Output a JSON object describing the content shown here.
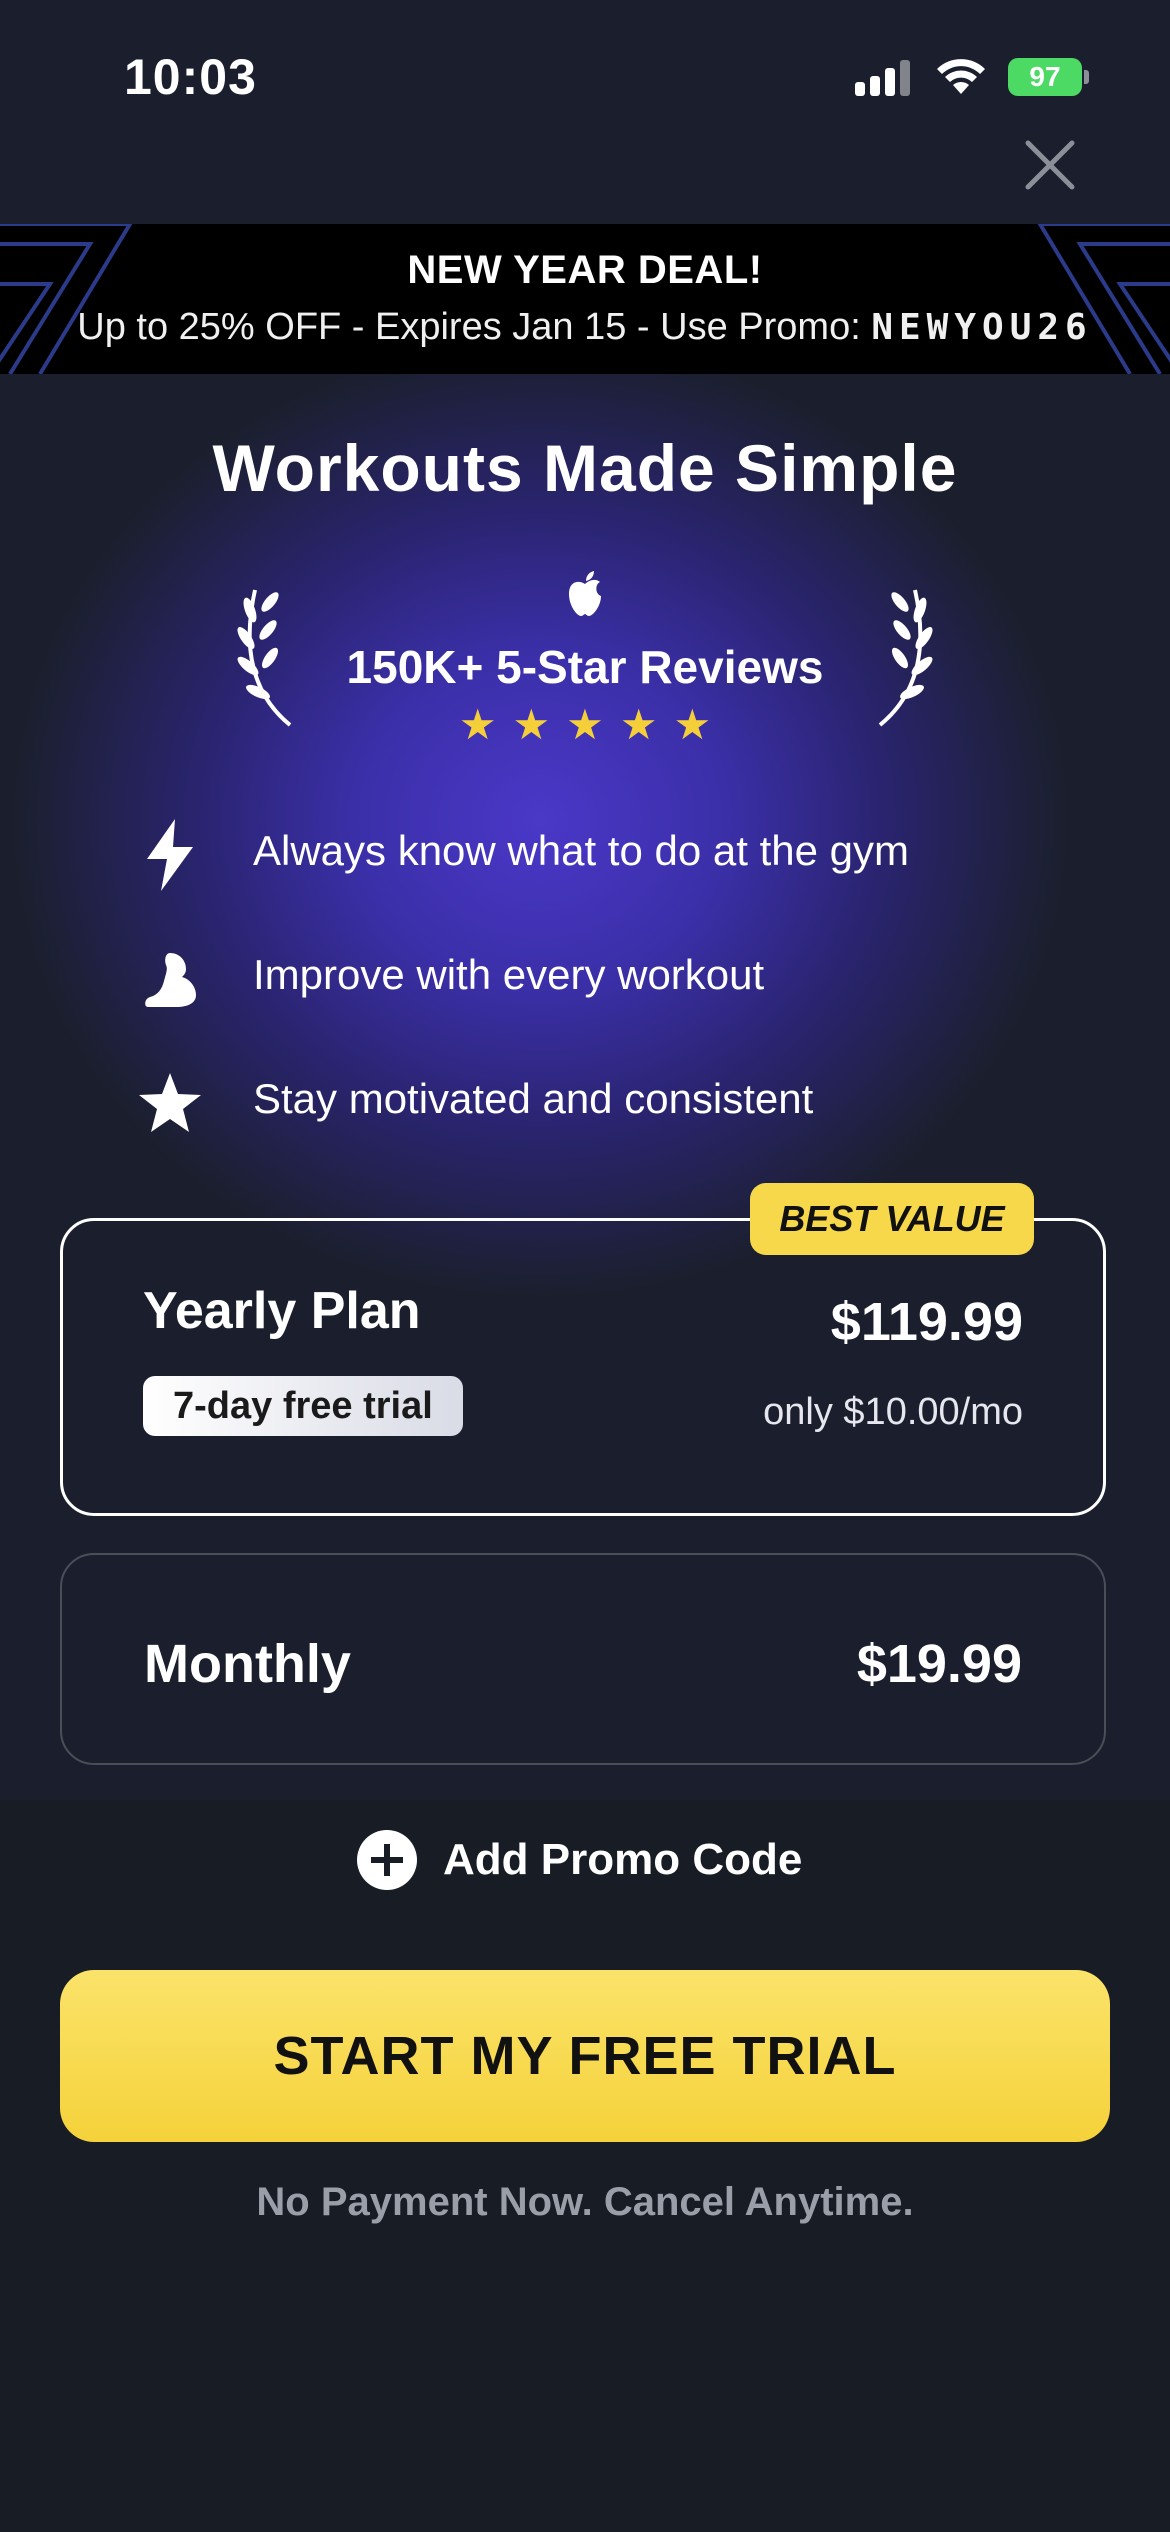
{
  "status_bar": {
    "time": "10:03",
    "battery": "97"
  },
  "promo_banner": {
    "title": "NEW YEAR DEAL!",
    "line": "Up to 25% OFF - Expires Jan 15 - Use Promo:",
    "code": "NEWYOU26"
  },
  "headline": "Workouts Made Simple",
  "reviews": {
    "text": "150K+ 5-Star Reviews",
    "stars": 5
  },
  "features": [
    {
      "icon": "lightning-icon",
      "text": "Always know what to do at the gym"
    },
    {
      "icon": "flexed-bicep-icon",
      "text": "Improve with every workout"
    },
    {
      "icon": "star-icon",
      "text": "Stay motivated and consistent"
    }
  ],
  "plans": {
    "yearly": {
      "badge": "BEST VALUE",
      "name": "Yearly Plan",
      "trial": "7-day free trial",
      "price": "$119.99",
      "per_month": "only $10.00/mo"
    },
    "monthly": {
      "name": "Monthly",
      "price": "$19.99"
    }
  },
  "promo_add_label": "Add Promo Code",
  "cta": {
    "label": "START MY FREE TRIAL",
    "note": "No Payment Now. Cancel Anytime."
  },
  "colors": {
    "accent": "#f7d84a",
    "battery": "#4cd964",
    "background": "#181c24",
    "glow": "#4a38c8"
  }
}
